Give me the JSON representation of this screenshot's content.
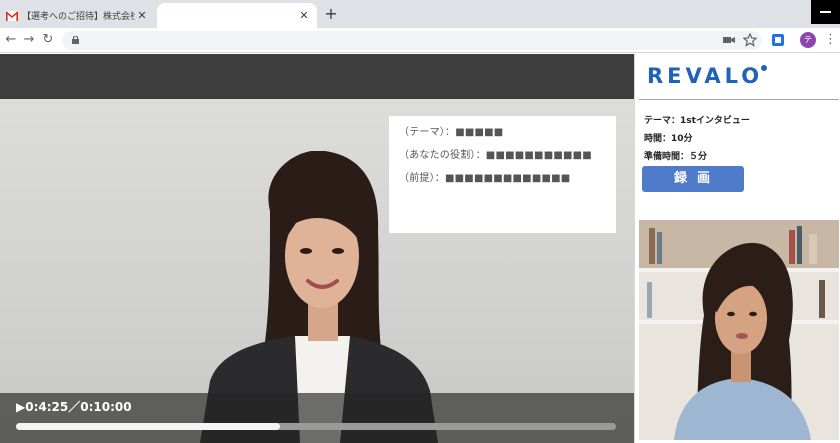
{
  "browser": {
    "tabs": [
      {
        "title": "【選考へのご招待】株式会社レバロ",
        "icon": "gmail-icon",
        "close": "✕"
      },
      {
        "title": "",
        "close": "✕"
      }
    ],
    "new_tab": "+",
    "back": "←",
    "forward": "→",
    "reload": "↻",
    "avatar_letter": "テ",
    "menu": "⋮"
  },
  "video": {
    "theme_card": {
      "theme": "（テーマ）：■■■■■",
      "role": "（あなたの役割）：■■■■■■■■■■■",
      "premise": "（前提）：■■■■■■■■■■■■■"
    },
    "time": "▶0:4:25／0:10:00",
    "progress": 0.44
  },
  "panel": {
    "logo": "REVALO",
    "theme": "テーマ：1stインタビュー",
    "duration": "時間：10分",
    "prep": "準備時間：５分",
    "record_label": "録画"
  },
  "colors": {
    "brand": "#1f62b8",
    "record_button": "#4f7cc9",
    "video_topbar": "#3d3d3d"
  }
}
